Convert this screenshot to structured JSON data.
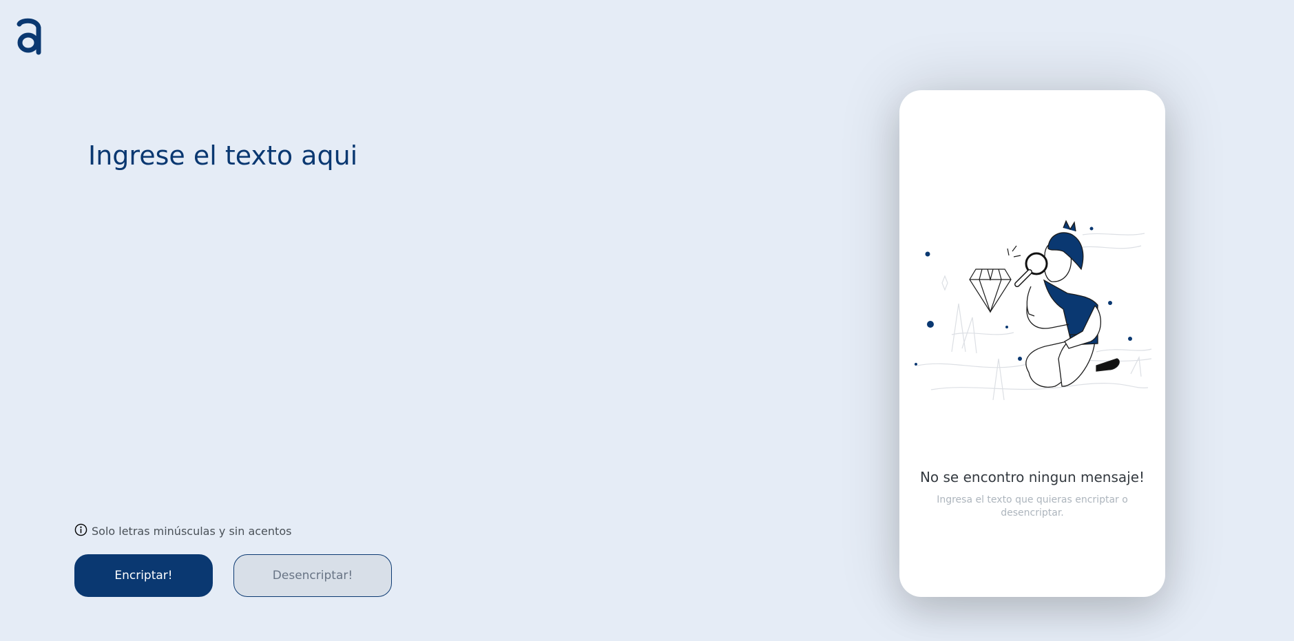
{
  "brand": {
    "logo_icon": "alura-a-logo-icon",
    "color": "#0a3871"
  },
  "input": {
    "placeholder": "Ingrese el texto aqui",
    "value": ""
  },
  "hint": {
    "icon": "info-icon",
    "text": "Solo letras minúsculas y sin acentos"
  },
  "buttons": {
    "encrypt_label": "Encriptar!",
    "decrypt_label": "Desencriptar!"
  },
  "output": {
    "illustration": "person-with-magnifying-glass-and-diamond",
    "empty_title": "No se encontro ningun mensaje!",
    "empty_subtitle": "Ingresa el texto que quieras encriptar o desencriptar."
  },
  "colors": {
    "background": "#e5ecf6",
    "primary": "#0a3871",
    "secondary_button_bg": "#d8dfe8",
    "card": "#ffffff"
  }
}
